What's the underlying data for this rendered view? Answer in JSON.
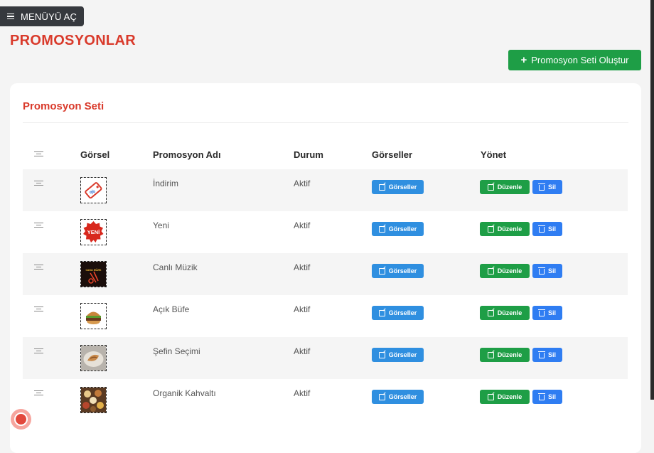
{
  "menu": {
    "label": "MENÜYÜ AÇ",
    "icon": "hamburger-icon"
  },
  "page": {
    "title": "PROMOSYONLAR"
  },
  "create_button": {
    "label": "Promosyon Seti Oluştur",
    "icon": "plus-icon"
  },
  "card": {
    "title": "Promosyon Seti"
  },
  "table": {
    "headers": {
      "drag": "drag-handle-icon",
      "image": "Görsel",
      "name": "Promosyon Adı",
      "status": "Durum",
      "images": "Görseller",
      "manage": "Yönet"
    },
    "rows": [
      {
        "name": "İndirim",
        "status": "Aktif",
        "thumb": "discount-tag",
        "thumb_text": "%"
      },
      {
        "name": "Yeni",
        "status": "Aktif",
        "thumb": "new-badge",
        "thumb_text": "YENİ"
      },
      {
        "name": "Canlı Müzik",
        "status": "Aktif",
        "thumb": "live-music",
        "thumb_text": "CANLI MÜZİK"
      },
      {
        "name": "Açık Büfe",
        "status": "Aktif",
        "thumb": "burger"
      },
      {
        "name": "Şefin Seçimi",
        "status": "Aktif",
        "thumb": "chef-plate"
      },
      {
        "name": "Organik Kahvaltı",
        "status": "Aktif",
        "thumb": "breakfast"
      }
    ],
    "buttons": {
      "images": "Görseller",
      "edit": "Düzenle",
      "delete": "Sil"
    }
  },
  "colors": {
    "accent_red": "#d93a2b",
    "green": "#1e9e46",
    "blue": "#2f8fe0",
    "dark": "#36393e"
  }
}
